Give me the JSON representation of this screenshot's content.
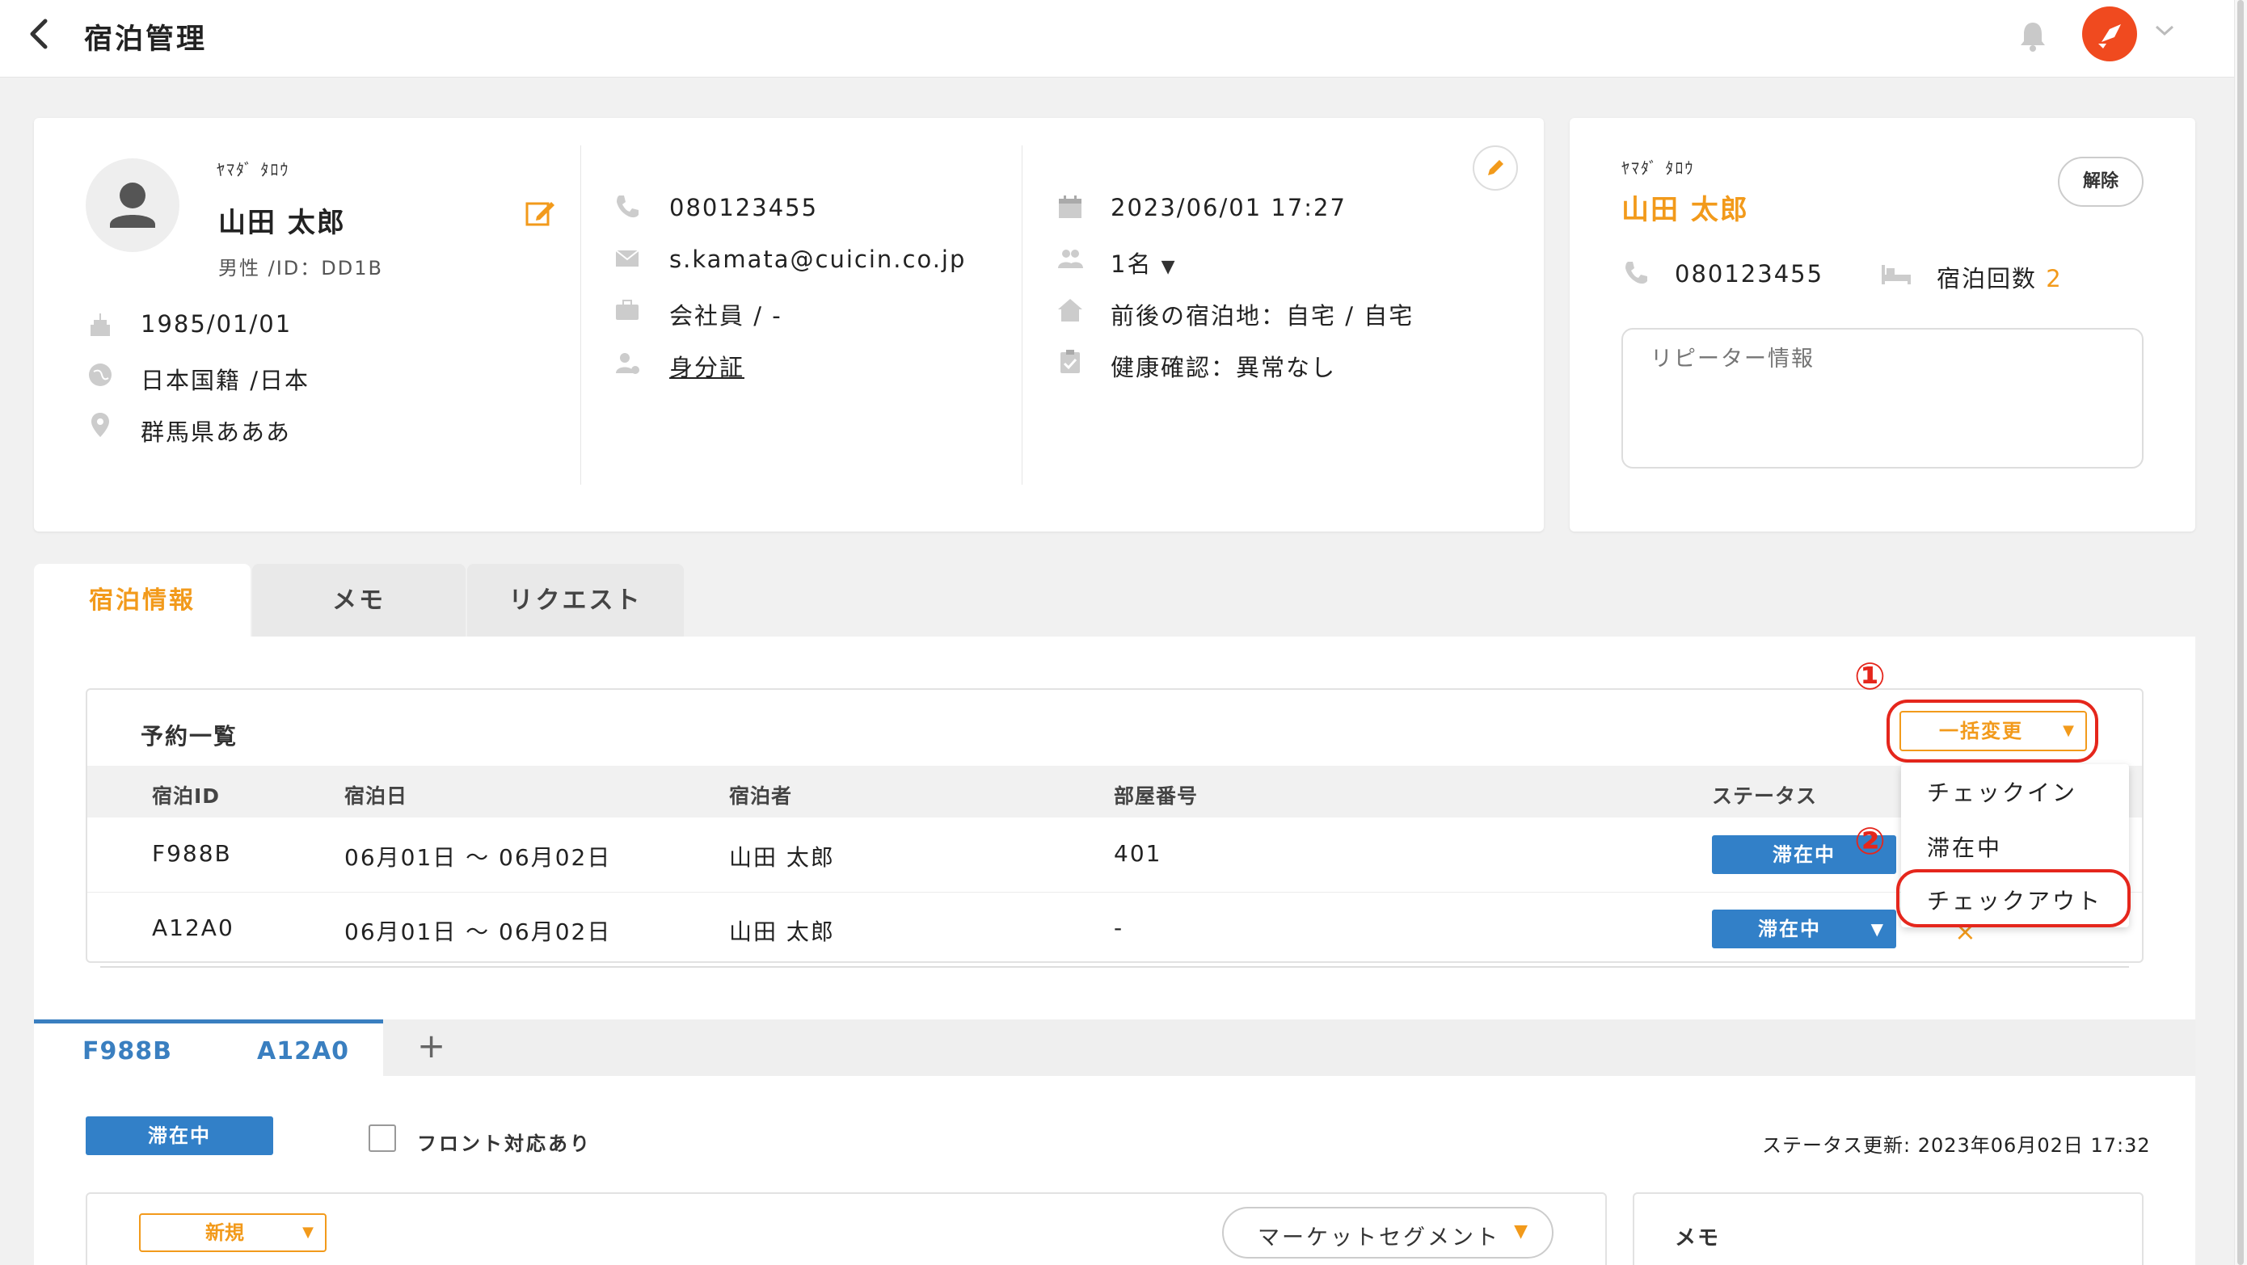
{
  "header": {
    "title": "宿泊管理"
  },
  "guest": {
    "kana": "ﾔﾏﾀﾞ ﾀﾛｳ",
    "name": "山田 太郎",
    "gender_id": "男性 /ID：DD1B",
    "birthday": "1985/01/01",
    "nationality": "日本国籍 /日本",
    "address": "群馬県あああ",
    "phone": "080123455",
    "email": "s.kamata@cuicin.co.jp",
    "occupation": "会社員 / -",
    "id_doc": "身分証",
    "checkin_datetime": "2023/06/01 17:27",
    "guests": "1名",
    "prev_next": "前後の宿泊地：自宅 / 自宅",
    "health": "健康確認：異常なし"
  },
  "repeater": {
    "kana": "ﾔﾏﾀﾞ ﾀﾛｳ",
    "name": "山田 太郎",
    "release_label": "解除",
    "phone": "080123455",
    "stay_count_label": "宿泊回数",
    "stay_count": "2",
    "info_placeholder": "リピーター情報"
  },
  "tabs": [
    {
      "label": "宿泊情報",
      "active": true
    },
    {
      "label": "メモ",
      "active": false
    },
    {
      "label": "リクエスト",
      "active": false
    }
  ],
  "reservations": {
    "title": "予約一覧",
    "bulk_change_label": "一括変更",
    "columns": [
      "宿泊ID",
      "宿泊日",
      "宿泊者",
      "部屋番号",
      "ステータス"
    ],
    "rows": [
      {
        "id": "F988B",
        "dates": "06月01日 ～ 06月02日",
        "guest": "山田 太郎",
        "room": "401",
        "status": "滞在中"
      },
      {
        "id": "A12A0",
        "dates": "06月01日 ～ 06月02日",
        "guest": "山田 太郎",
        "room": "-",
        "status": "滞在中"
      }
    ],
    "menu": [
      "チェックイン",
      "滞在中",
      "チェックアウト"
    ],
    "annotations": [
      "①",
      "②"
    ]
  },
  "detail": {
    "subtabs": [
      "F988B",
      "A12A0"
    ],
    "add_label": "+",
    "status": "滞在中",
    "front_label": "フロント対応あり",
    "status_updated": "ステータス更新: 2023年06月02日 17:32",
    "category": "新規",
    "segment_label": "マーケットセグメント",
    "memo_label": "メモ"
  },
  "colors": {
    "accent": "#f29a1b",
    "status_blue": "#3280c8",
    "highlight_red": "#e5261c",
    "brand": "#f04a1f"
  }
}
